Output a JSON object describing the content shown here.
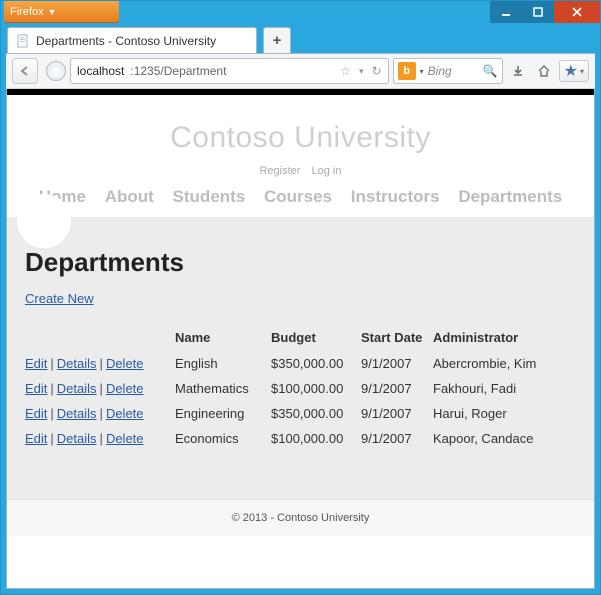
{
  "chrome": {
    "firefox_label": "Firefox",
    "tab_title": "Departments - Contoso University",
    "url_host": "localhost",
    "url_path": ":1235/Department",
    "search_placeholder": "Bing"
  },
  "page": {
    "site_title": "Contoso University",
    "auth": {
      "register": "Register",
      "login": "Log in"
    },
    "nav": [
      "Home",
      "About",
      "Students",
      "Courses",
      "Instructors",
      "Departments"
    ],
    "heading": "Departments",
    "create_new": "Create New",
    "actions": {
      "edit": "Edit",
      "details": "Details",
      "delete": "Delete"
    },
    "table": {
      "headers": [
        "Name",
        "Budget",
        "Start Date",
        "Administrator"
      ],
      "rows": [
        {
          "name": "English",
          "budget": "$350,000.00",
          "start": "9/1/2007",
          "admin": "Abercrombie, Kim"
        },
        {
          "name": "Mathematics",
          "budget": "$100,000.00",
          "start": "9/1/2007",
          "admin": "Fakhouri, Fadi"
        },
        {
          "name": "Engineering",
          "budget": "$350,000.00",
          "start": "9/1/2007",
          "admin": "Harui, Roger"
        },
        {
          "name": "Economics",
          "budget": "$100,000.00",
          "start": "9/1/2007",
          "admin": "Kapoor, Candace"
        }
      ]
    },
    "footer": "© 2013 - Contoso University"
  }
}
